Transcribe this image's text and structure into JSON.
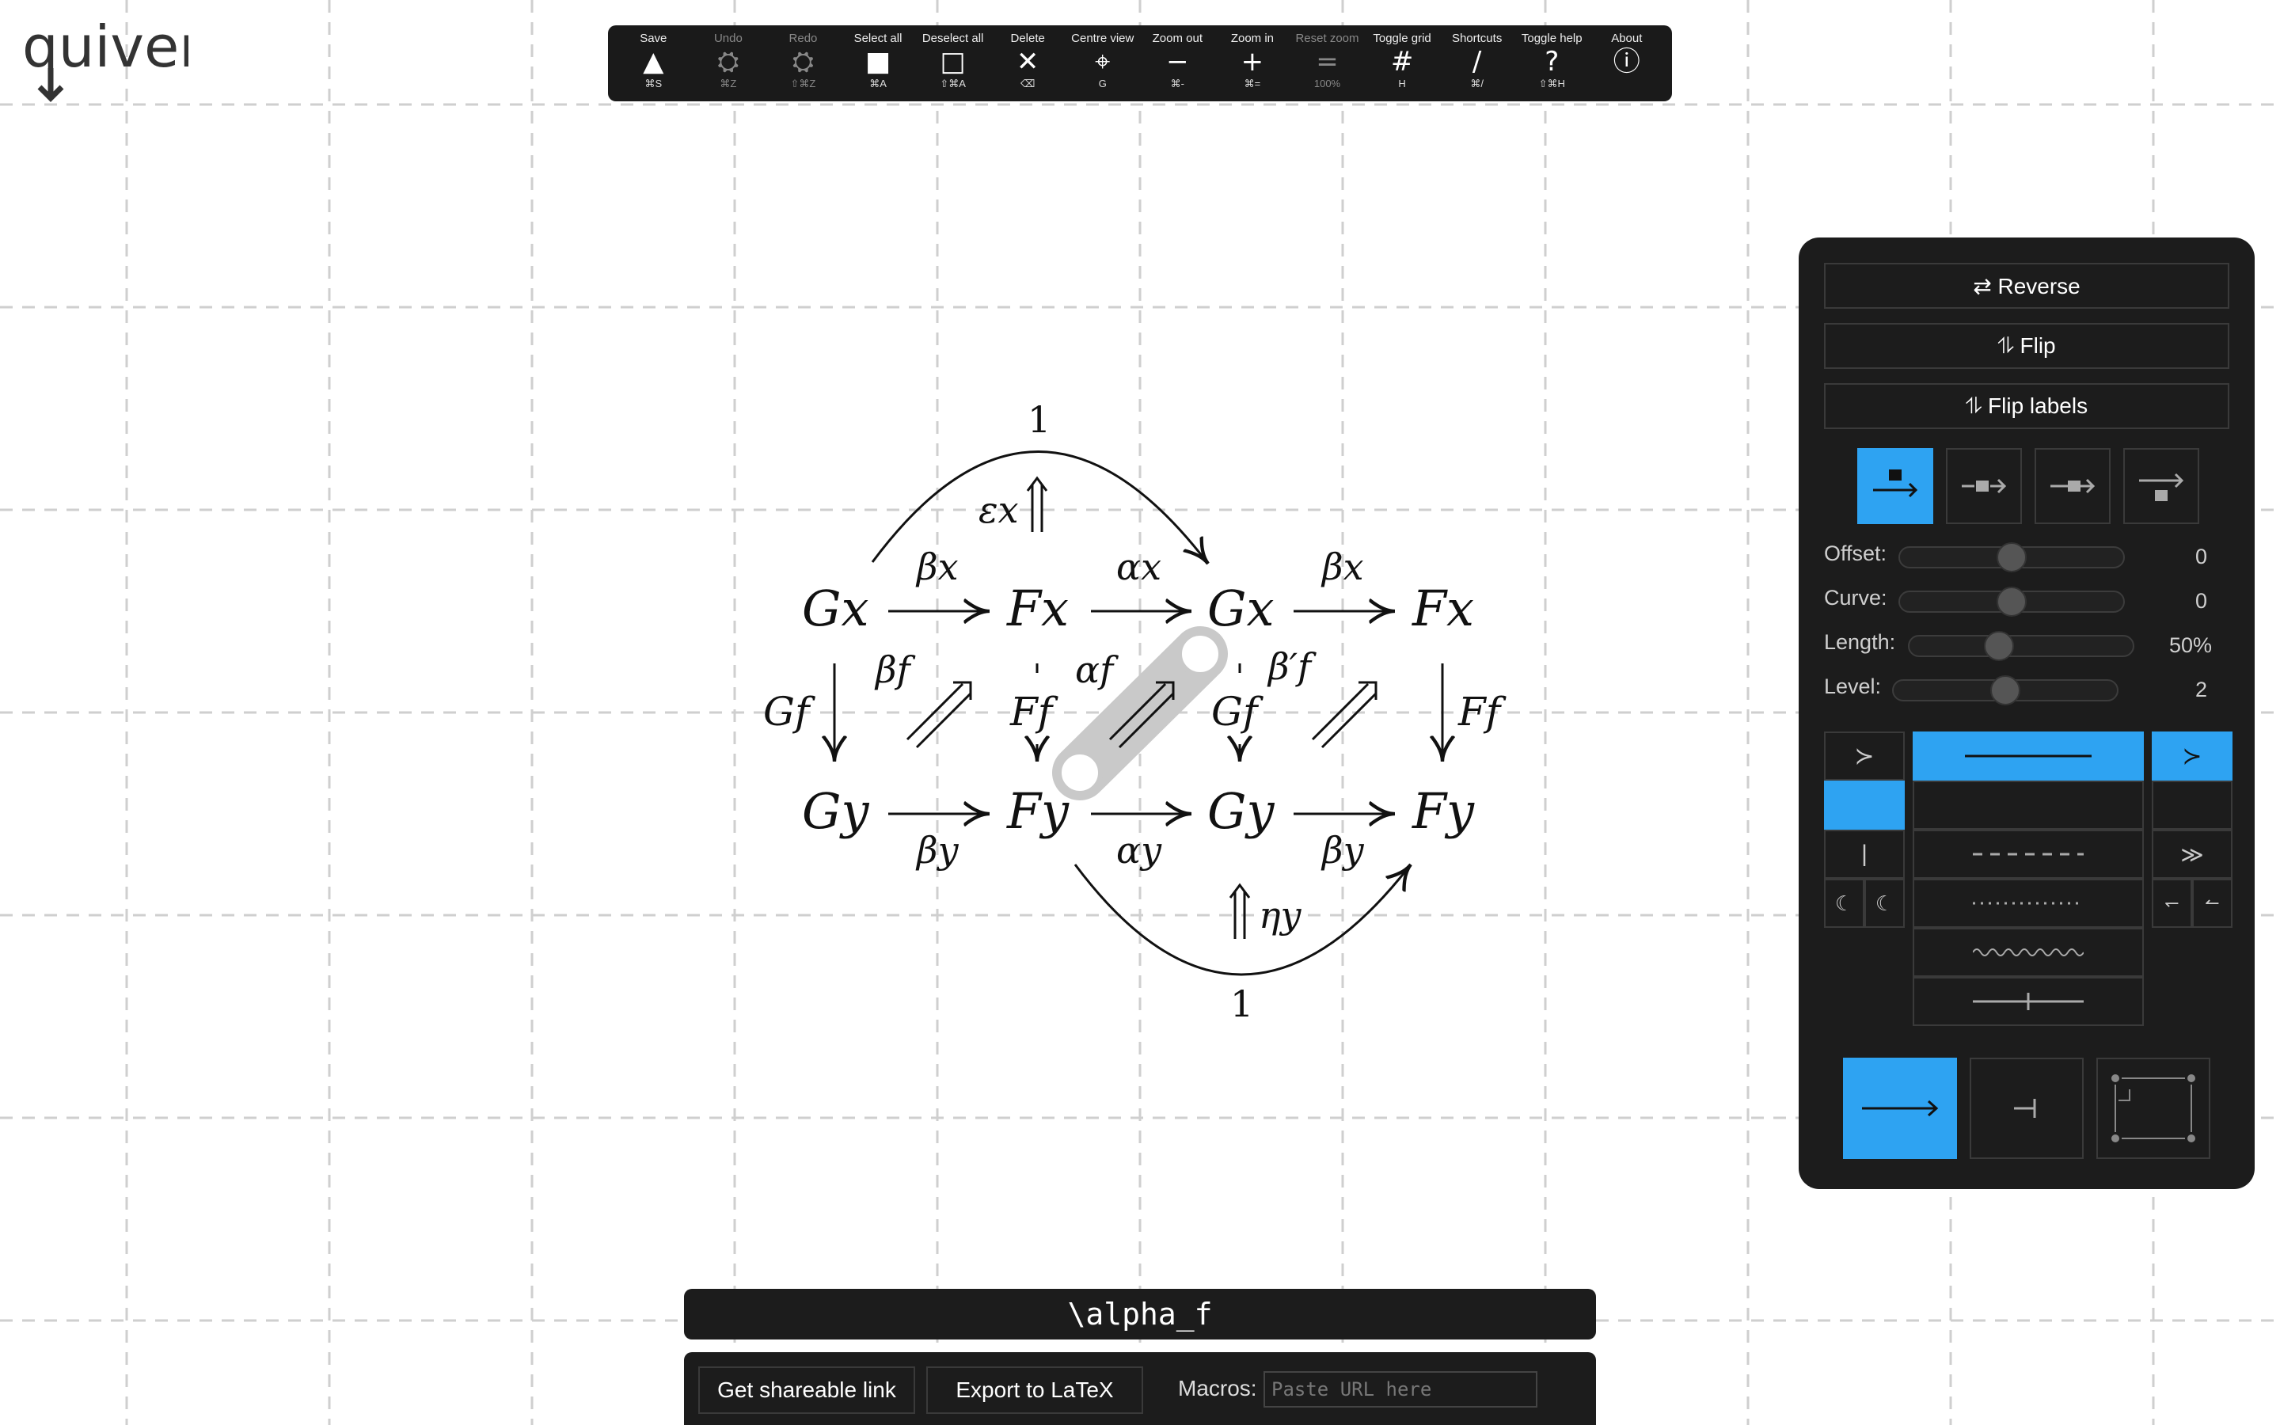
{
  "app": {
    "logo": "quiver"
  },
  "toolbar": [
    {
      "name": "Save",
      "icon": "▲",
      "key": "⌘S",
      "disabled": false
    },
    {
      "name": "Undo",
      "icon": "⛭",
      "key": "⌘Z",
      "disabled": true
    },
    {
      "name": "Redo",
      "icon": "⛭",
      "key": "⇧⌘Z",
      "disabled": true
    },
    {
      "name": "Select all",
      "icon": "■",
      "key": "⌘A",
      "disabled": false
    },
    {
      "name": "Deselect all",
      "icon": "□",
      "key": "⇧⌘A",
      "disabled": false
    },
    {
      "name": "Delete",
      "icon": "✕",
      "key": "⌫",
      "disabled": false
    },
    {
      "name": "Centre view",
      "icon": "⌖",
      "key": "G",
      "disabled": false
    },
    {
      "name": "Zoom out",
      "icon": "−",
      "key": "⌘-",
      "disabled": false
    },
    {
      "name": "Zoom in",
      "icon": "+",
      "key": "⌘=",
      "disabled": false
    },
    {
      "name": "Reset zoom",
      "icon": "=",
      "key": "100%",
      "disabled": true
    },
    {
      "name": "Toggle grid",
      "icon": "#",
      "key": "H",
      "disabled": false
    },
    {
      "name": "Shortcuts",
      "icon": "/",
      "key": "⌘/",
      "disabled": false
    },
    {
      "name": "Toggle help",
      "icon": "?",
      "key": "⇧⌘H",
      "disabled": false
    },
    {
      "name": "About",
      "icon": "ⓘ",
      "key": "",
      "disabled": false
    }
  ],
  "panel": {
    "reverse": "⇄ Reverse",
    "flip": "⥮ Flip",
    "flip_labels": "⥮ Flip labels",
    "sliders": [
      {
        "label": "Offset:",
        "value": "0",
        "fraction": 0.5
      },
      {
        "label": "Curve:",
        "value": "0",
        "fraction": 0.5
      },
      {
        "label": "Length:",
        "value": "50%",
        "fraction": 0.4
      },
      {
        "label": "Level:",
        "value": "2",
        "fraction": 0.5
      }
    ],
    "label_positions_selected": 0,
    "accent": "#2ea3f2"
  },
  "label_input": {
    "value": "\\alpha_f"
  },
  "bottom": {
    "share": "Get shareable link",
    "export": "Export to LaTeX",
    "macros_label": "Macros:",
    "macros_placeholder": "Paste URL here"
  },
  "diagram": {
    "objects": [
      {
        "id": "Gx1",
        "label": "Gx"
      },
      {
        "id": "Fx1",
        "label": "Fx"
      },
      {
        "id": "Gx2",
        "label": "Gx"
      },
      {
        "id": "Fx2",
        "label": "Fx"
      },
      {
        "id": "Gy1",
        "label": "Gy"
      },
      {
        "id": "Fy1",
        "label": "Fy"
      },
      {
        "id": "Gy2",
        "label": "Gy"
      },
      {
        "id": "Fy2",
        "label": "Fy"
      },
      {
        "id": "top1",
        "label": "1"
      },
      {
        "id": "bot1",
        "label": "1"
      }
    ],
    "arrow_labels": {
      "beta_x_1": "βx",
      "alpha_x": "αx",
      "beta_x_2": "βx",
      "Gf_1": "Gf",
      "beta_f": "βf",
      "Ff": "Ff",
      "alpha_f": "αf",
      "Gf_2": "Gf",
      "beta_prime_f": "β′f",
      "Ff_2": "Ff",
      "beta_y_1": "βy",
      "alpha_y": "αy",
      "beta_y_2": "βy",
      "eps_x": "εx",
      "eta_y": "ηy"
    }
  }
}
